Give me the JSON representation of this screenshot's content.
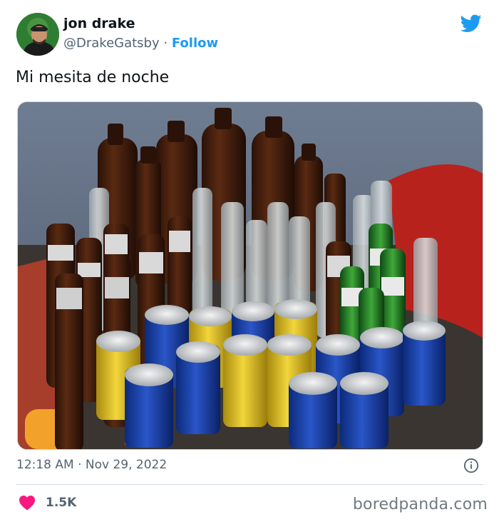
{
  "user": {
    "name": "jon drake",
    "handle": "@DrakeGatsby",
    "separator": "·",
    "follow_label": "Follow"
  },
  "tweet": {
    "text": "Mi mesita de noche",
    "timestamp": "12:18 AM · Nov 29, 2022",
    "likes": "1.5K"
  },
  "icons": {
    "brand": "twitter-bird-icon",
    "info": "info-icon",
    "like": "heart-icon"
  },
  "watermark": "boredpanda.com",
  "colors": {
    "accent": "#1d9bf0",
    "heart": "#f91880",
    "text": "#0f1419",
    "muted": "#536471"
  }
}
